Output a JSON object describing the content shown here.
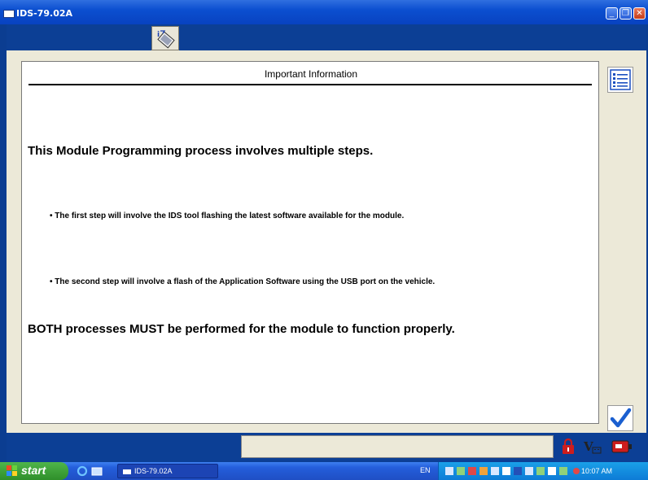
{
  "window": {
    "title": "IDS-79.02A"
  },
  "content": {
    "heading": "Important Information",
    "intro": "This Module Programming process involves multiple steps.",
    "bullets": [
      "• The first step will involve the IDS tool flashing the latest software available for the module.",
      "• The second step will involve a flash of the Application Software using the USB port on the vehicle."
    ],
    "closing": "BOTH processes MUST be performed for the module to function properly."
  },
  "taskbar": {
    "start_label": "start",
    "task_label": "IDS-79.02A",
    "language": "EN",
    "clock": "10:07 AM"
  },
  "colors": {
    "accent": "#0b3d91",
    "confirm": "#1a5fd0",
    "lock": "#cc1d1d"
  }
}
